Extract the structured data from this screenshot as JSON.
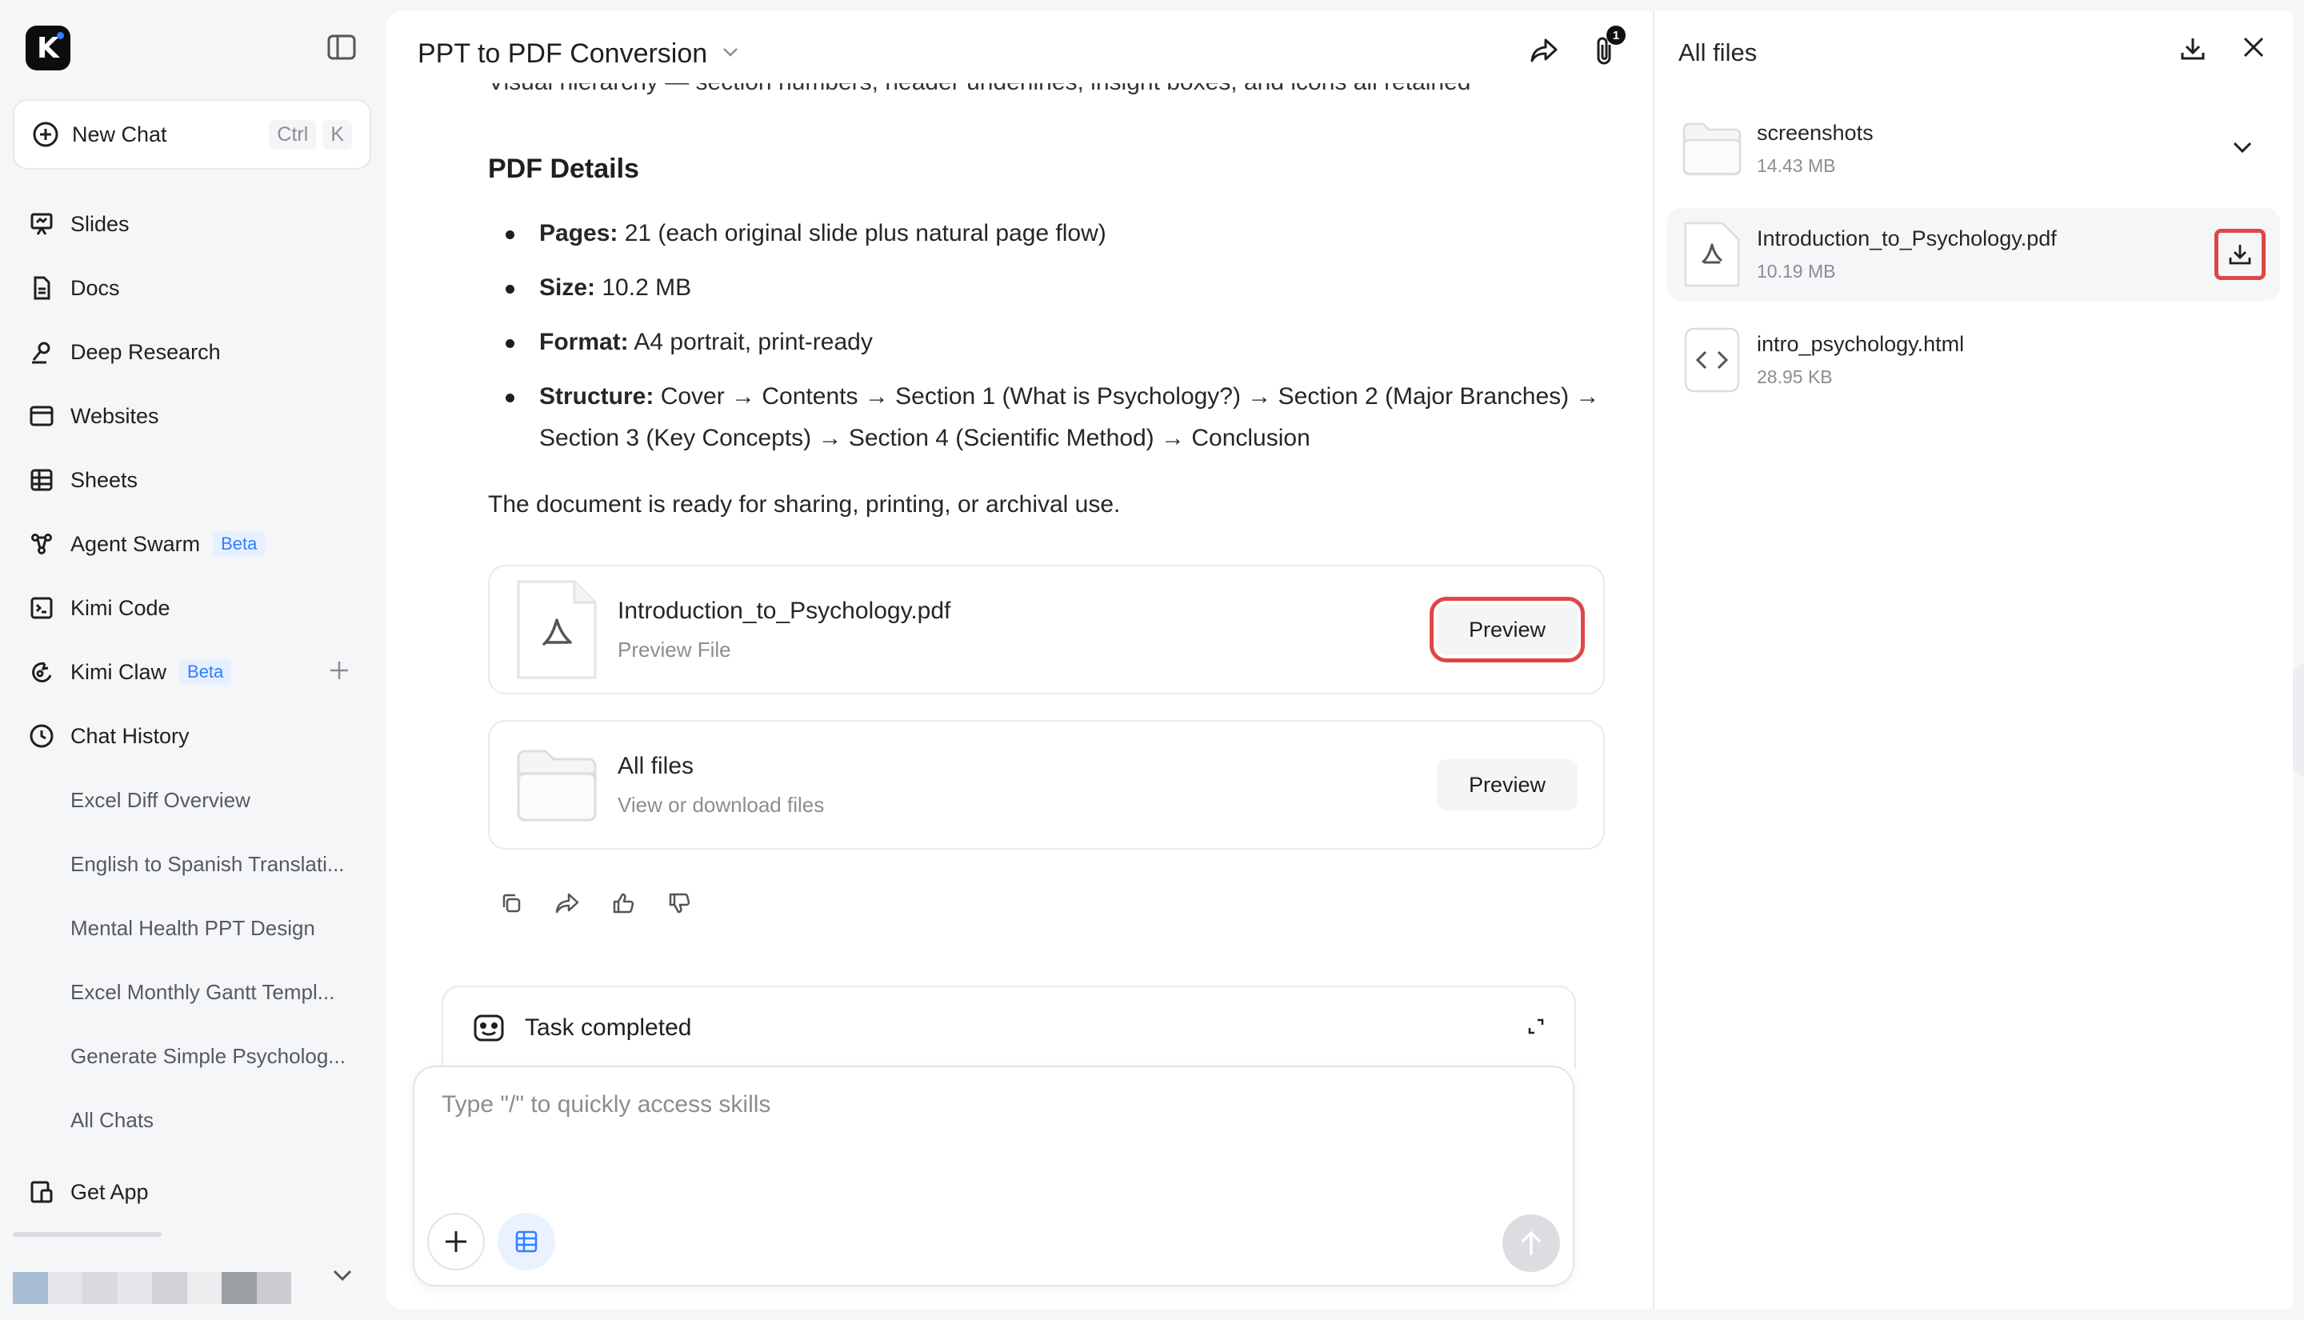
{
  "sidebar": {
    "new_chat": {
      "label": "New Chat",
      "shortcut": [
        "Ctrl",
        "K"
      ]
    },
    "nav": [
      {
        "label": "Slides",
        "icon": "slides-icon"
      },
      {
        "label": "Docs",
        "icon": "doc-icon"
      },
      {
        "label": "Deep Research",
        "icon": "research-icon"
      },
      {
        "label": "Websites",
        "icon": "browser-icon"
      },
      {
        "label": "Sheets",
        "icon": "table-icon"
      },
      {
        "label": "Agent Swarm",
        "icon": "swarm-icon",
        "badge": "Beta"
      },
      {
        "label": "Kimi Code",
        "icon": "terminal-icon"
      },
      {
        "label": "Kimi Claw",
        "icon": "claw-icon",
        "badge": "Beta"
      },
      {
        "label": "Chat History",
        "icon": "clock-icon"
      }
    ],
    "history": [
      "Excel Diff Overview",
      "English to Spanish Translati...",
      "Mental Health PPT Design",
      "Excel Monthly Gantt Templ...",
      "Generate Simple Psycholog...",
      "All Chats"
    ],
    "get_app": "Get App"
  },
  "header": {
    "title": "PPT to PDF Conversion",
    "attachment_count": "1"
  },
  "message": {
    "cut_line": "Visual hierarchy — section numbers, header underlines, insight boxes, and icons all retained",
    "section_title": "PDF Details",
    "details": [
      {
        "label": "Pages:",
        "text": " 21 (each original slide plus natural page flow)"
      },
      {
        "label": "Size:",
        "text": " 10.2 MB"
      },
      {
        "label": "Format:",
        "text": " A4 portrait, print-ready"
      },
      {
        "label": "Structure:",
        "text": " Cover → Contents → Section 1 (What is Psychology?) → Section 2 (Major Branches) → Section 3 (Key Concepts) → Section 4 (Scientific Method) → Conclusion"
      }
    ],
    "closing": "The document is ready for sharing, printing, or archival use.",
    "cards": [
      {
        "name": "Introduction_to_Psychology.pdf",
        "sub": "Preview File",
        "button": "Preview"
      },
      {
        "name": "All files",
        "sub": "View or download files",
        "button": "Preview"
      }
    ]
  },
  "task": {
    "label": "Task completed"
  },
  "composer": {
    "placeholder": "Type \"/\" to quickly access skills"
  },
  "panel": {
    "title": "All files",
    "files": [
      {
        "name": "screenshots",
        "size": "14.43 MB",
        "type": "folder"
      },
      {
        "name": "Introduction_to_Psychology.pdf",
        "size": "10.19 MB",
        "type": "pdf"
      },
      {
        "name": "intro_psychology.html",
        "size": "28.95 KB",
        "type": "html"
      }
    ]
  },
  "colors": {
    "accent_blue": "#2f80ff",
    "highlight_red": "#e04646",
    "sidebar_bg": "#f5f6f8"
  }
}
